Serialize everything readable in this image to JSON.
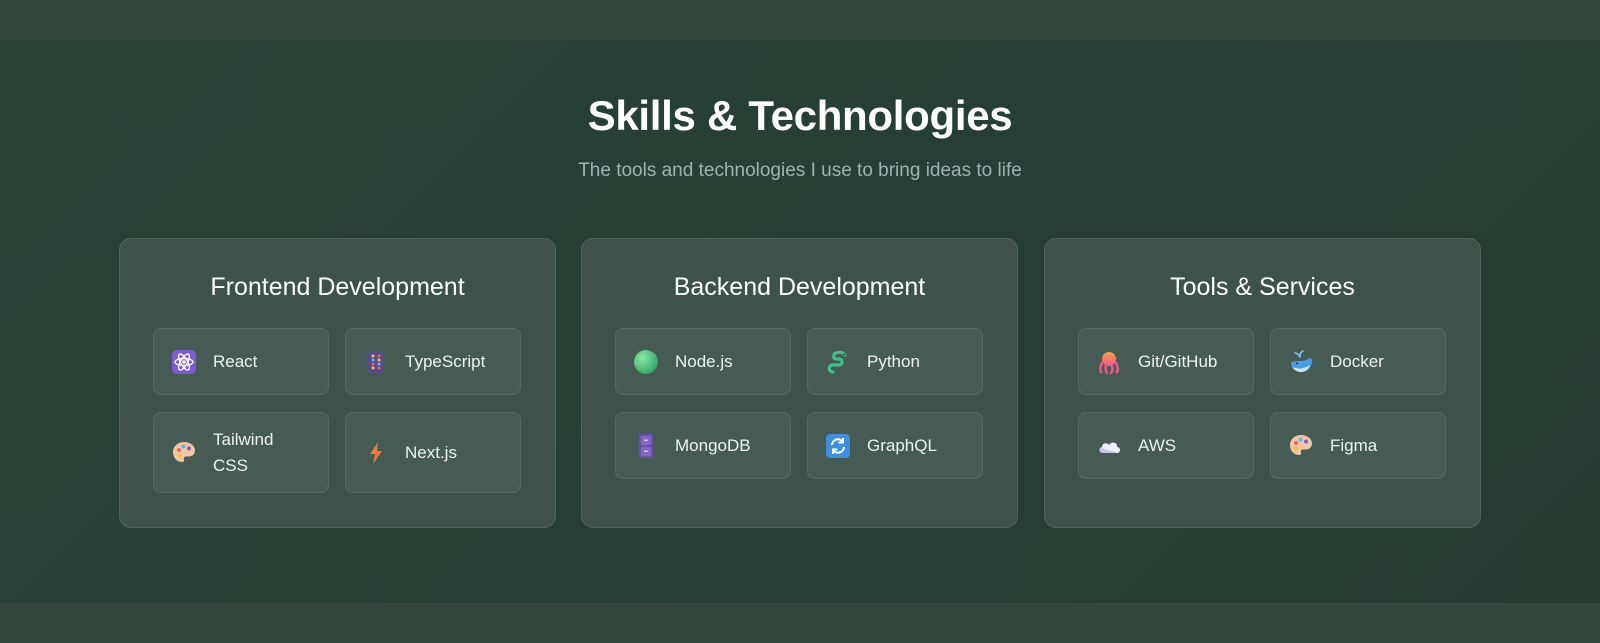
{
  "header": {
    "title": "Skills & Technologies",
    "subtitle": "The tools and technologies I use to bring ideas to life"
  },
  "categories": [
    {
      "title": "Frontend Development",
      "items": [
        {
          "label": "React",
          "icon": "atom-icon"
        },
        {
          "label": "TypeScript",
          "icon": "abacus-icon"
        },
        {
          "label": "Tailwind CSS",
          "icon": "palette-icon"
        },
        {
          "label": "Next.js",
          "icon": "lightning-icon"
        }
      ]
    },
    {
      "title": "Backend Development",
      "items": [
        {
          "label": "Node.js",
          "icon": "green-circle-icon"
        },
        {
          "label": "Python",
          "icon": "snake-icon"
        },
        {
          "label": "MongoDB",
          "icon": "file-cabinet-icon"
        },
        {
          "label": "GraphQL",
          "icon": "refresh-arrows-icon"
        }
      ]
    },
    {
      "title": "Tools & Services",
      "items": [
        {
          "label": "Git/GitHub",
          "icon": "octopus-icon"
        },
        {
          "label": "Docker",
          "icon": "whale-icon"
        },
        {
          "label": "AWS",
          "icon": "cloud-icon"
        },
        {
          "label": "Figma",
          "icon": "palette-icon"
        }
      ]
    }
  ]
}
